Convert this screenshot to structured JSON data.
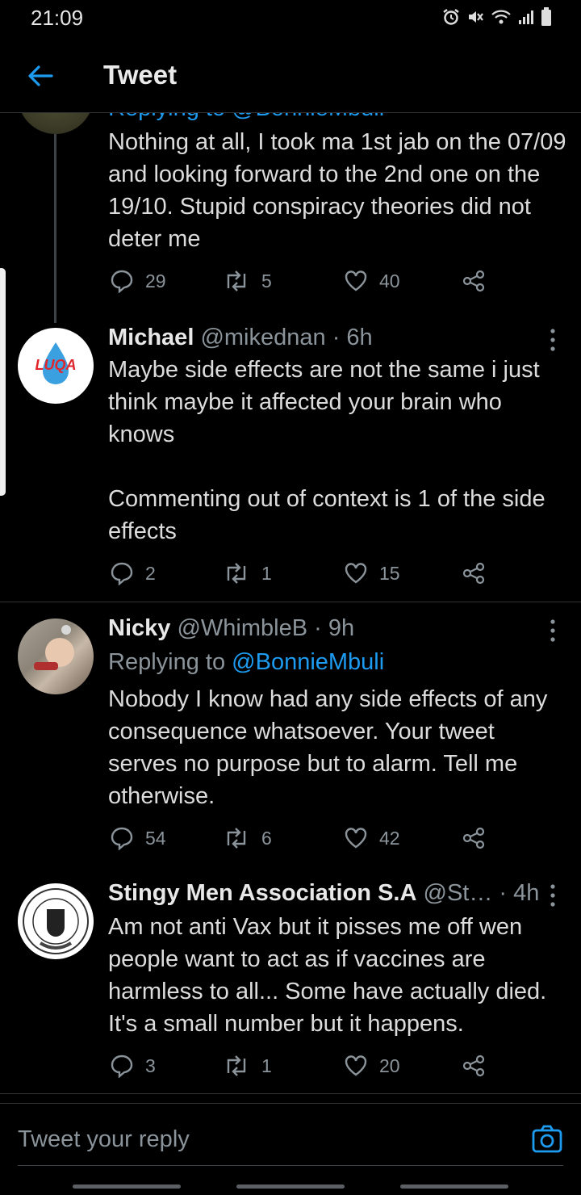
{
  "status": {
    "time": "21:09"
  },
  "header": {
    "title": "Tweet"
  },
  "tweets": [
    {
      "replying_partial": "Replying to @BonnieMbuli",
      "text": "Nothing at all, I took ma 1st jab on the 07/09 and looking forward to the 2nd one on the 19/10.  Stupid conspiracy theories did not deter me",
      "replies": "29",
      "retweets": "5",
      "likes": "40"
    },
    {
      "name": "Michael",
      "handle": "@mikednan",
      "time": "· 6h",
      "avatar_text": "LUQA",
      "text": "Maybe side effects are not the same i just think maybe it affected your brain who knows\n\nCommenting out of context is 1 of the side effects",
      "replies": "2",
      "retweets": "1",
      "likes": "15"
    },
    {
      "name": "Nicky",
      "handle": "@WhimbleB",
      "time": "· 9h",
      "replying_prefix": "Replying to",
      "replying_to": "@BonnieMbuli",
      "text": "Nobody I know had any side effects of any consequence whatsoever. Your tweet serves no purpose but to alarm. Tell me otherwise.",
      "replies": "54",
      "retweets": "6",
      "likes": "42"
    },
    {
      "name": "Stingy Men Association S.A",
      "handle": "@St…",
      "time": "· 4h",
      "text": "Am not anti Vax but it pisses me off wen people want to act as if vaccines are harmless to all... Some have actually died. It's a small number but it happens.",
      "replies": "3",
      "retweets": "1",
      "likes": "20"
    }
  ],
  "reply_box": {
    "placeholder": "Tweet your reply"
  },
  "colors": {
    "background": "#000000",
    "accent": "#1d9bf0",
    "text": "#dcdcdc",
    "muted": "#8b949a"
  }
}
